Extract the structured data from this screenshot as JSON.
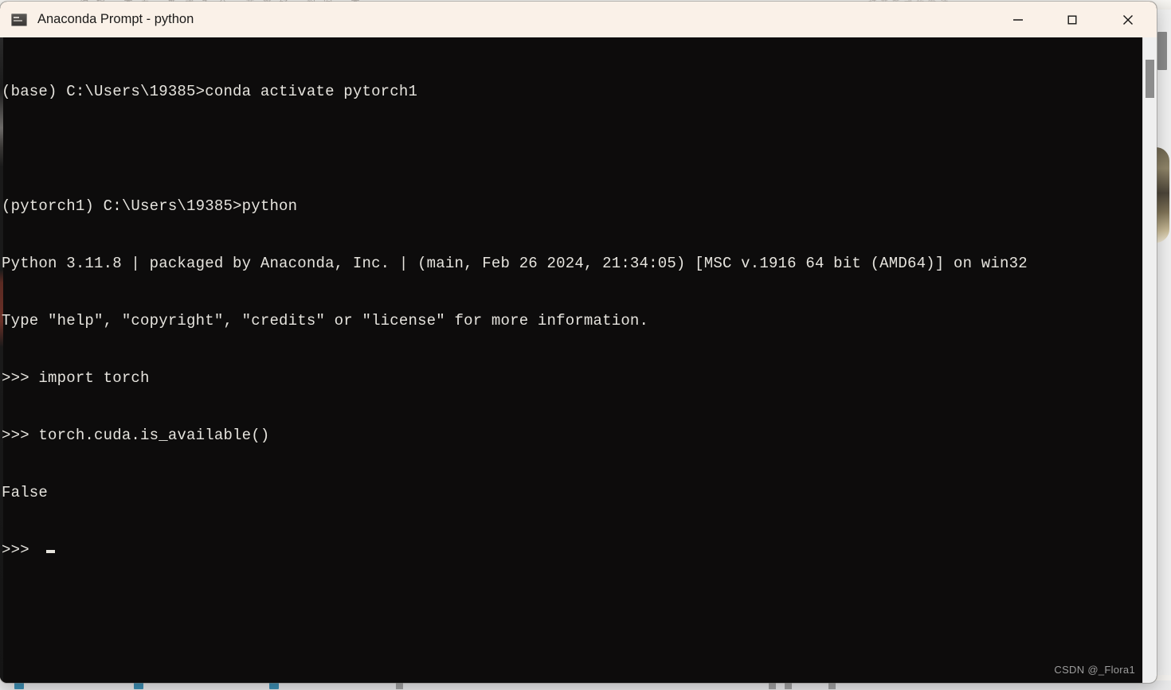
{
  "window": {
    "title": "Anaconda Prompt - python",
    "icon": "console-icon",
    "titlebar_color": "#faf1e8",
    "body_color": "#0d0c0c",
    "text_color": "#e6e4de",
    "controls": {
      "minimize_label": "Minimize",
      "maximize_label": "Maximize",
      "close_label": "Close"
    }
  },
  "console": {
    "lines": [
      "(base) C:\\Users\\19385>conda activate pytorch1",
      "",
      "(pytorch1) C:\\Users\\19385>python",
      "Python 3.11.8 | packaged by Anaconda, Inc. | (main, Feb 26 2024, 21:34:05) [MSC v.1916 64 bit (AMD64)] on win32",
      "Type \"help\", \"copyright\", \"credits\" or \"license\" for more information.",
      ">>> import torch",
      ">>> torch.cuda.is_available()",
      "False",
      ">>> "
    ],
    "prompt_base": "(base) C:\\Users\\19385>",
    "prompt_env": "(pytorch1) C:\\Users\\19385>",
    "commands": [
      "conda activate pytorch1",
      "python",
      "import torch",
      "torch.cuda.is_available()"
    ],
    "python_version": "3.11.8",
    "python_build": "main, Feb 26 2024, 21:34:05",
    "compiler": "MSC v.1916 64 bit (AMD64)",
    "platform": "win32",
    "result_value": "False",
    "cursor_visible": true
  },
  "scrollbar": {
    "thumb_top_pct": 3,
    "thumb_height_pct": 6
  },
  "background": {
    "menu_text_left": "编辑  查看  新成千台  蓝浆好  视图  查…",
    "menu_text_right": "打开新式的微波",
    "gold_accent": "#8f8468",
    "taskbar_accent": "#1f7ea8"
  },
  "watermark": {
    "text": "CSDN @_Flora1"
  }
}
